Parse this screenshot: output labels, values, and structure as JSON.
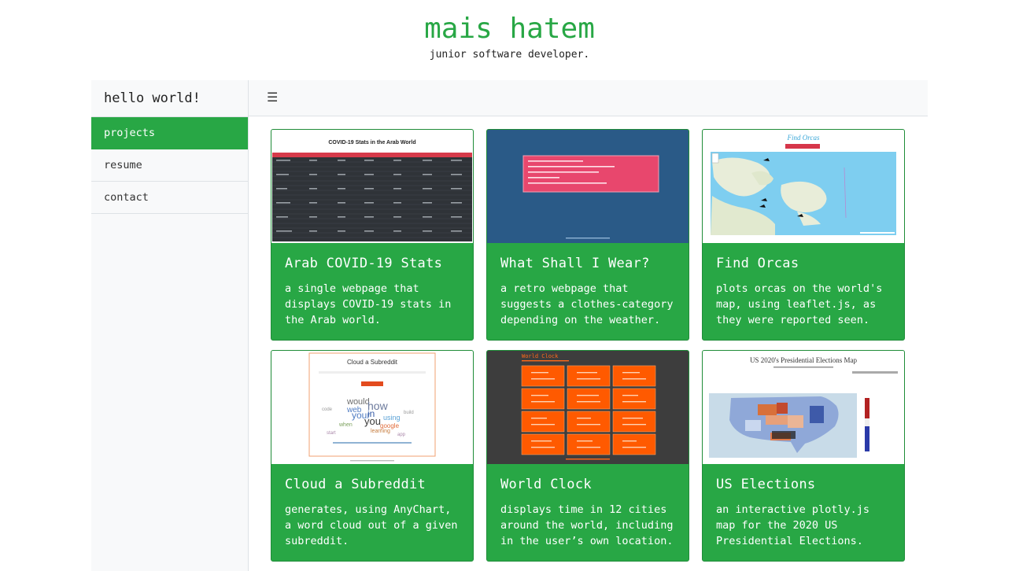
{
  "header": {
    "title": "mais hatem",
    "tagline": "junior software developer."
  },
  "sidebar": {
    "heading": "hello world!",
    "items": [
      {
        "label": "projects",
        "active": true
      },
      {
        "label": "resume",
        "active": false
      },
      {
        "label": "contact",
        "active": false
      }
    ]
  },
  "topbar": {
    "toggle_icon": "☰"
  },
  "colors": {
    "accent": "#28a745",
    "sidebar_bg": "#f8f9fa"
  },
  "projects": [
    {
      "title": "Arab COVID-19 Stats",
      "description": "a single webpage that displays COVID-19 stats in the Arab world.",
      "thumb_title": "COVID-19 Stats in the Arab World"
    },
    {
      "title": "What Shall I Wear?",
      "description": "a retro webpage that suggests a clothes-category depending on the weather."
    },
    {
      "title": "Find Orcas",
      "description": "plots orcas on the world's map, using leaflet.js, as they were reported seen.",
      "thumb_title": "Find Orcas"
    },
    {
      "title": "Cloud a Subreddit",
      "description": "generates, using AnyChart, a word cloud out of a given subreddit.",
      "thumb_title": "Cloud a Subreddit"
    },
    {
      "title": "World Clock",
      "description": "displays time in 12 cities around the world, including in the user’s own location.",
      "thumb_title": "World Clock"
    },
    {
      "title": "US Elections",
      "description": "an interactive plotly.js map for the 2020 US Presidential Elections.",
      "thumb_title": "US 2020's Presidential Elections Map"
    }
  ]
}
